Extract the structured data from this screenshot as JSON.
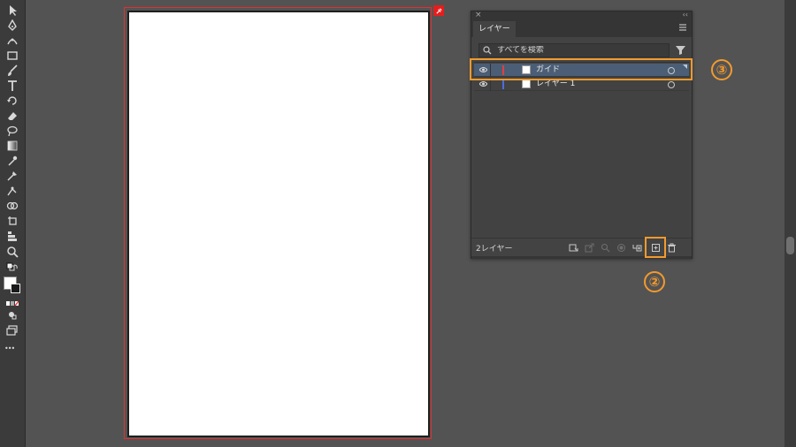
{
  "panel": {
    "close": "×",
    "collapse": "‹‹",
    "tab_label": "レイヤー",
    "search_placeholder": "すべてを検索",
    "layers": [
      {
        "name": "ガイド",
        "color": "#e04040",
        "selected": true
      },
      {
        "name": "レイヤー 1",
        "color": "#4a6ee0",
        "selected": false
      }
    ],
    "footer_count": "2レイヤー",
    "footer_icons": [
      "collect-export-icon",
      "export-icon",
      "locate-icon",
      "clipping-mask-icon",
      "new-sublayer-icon",
      "new-layer-icon",
      "delete-icon"
    ]
  },
  "annotations": {
    "new_layer_number": "②",
    "layer_row_number": "③",
    "color": "#f29a2e"
  },
  "toolbar": {
    "tools": [
      "selection-icon",
      "pen-icon",
      "curvature-icon",
      "rectangle-icon",
      "paintbrush-icon",
      "type-icon",
      "rotate-icon",
      "eraser-icon",
      "lasso-icon",
      "gradient-icon",
      "eyedropper-icon",
      "blend-icon",
      "puppet-warp-icon",
      "shape-builder-icon",
      "artboard-icon",
      "graph-icon",
      "zoom-icon"
    ],
    "more": "•••"
  },
  "artboard": {
    "border_color": "#e03030"
  }
}
